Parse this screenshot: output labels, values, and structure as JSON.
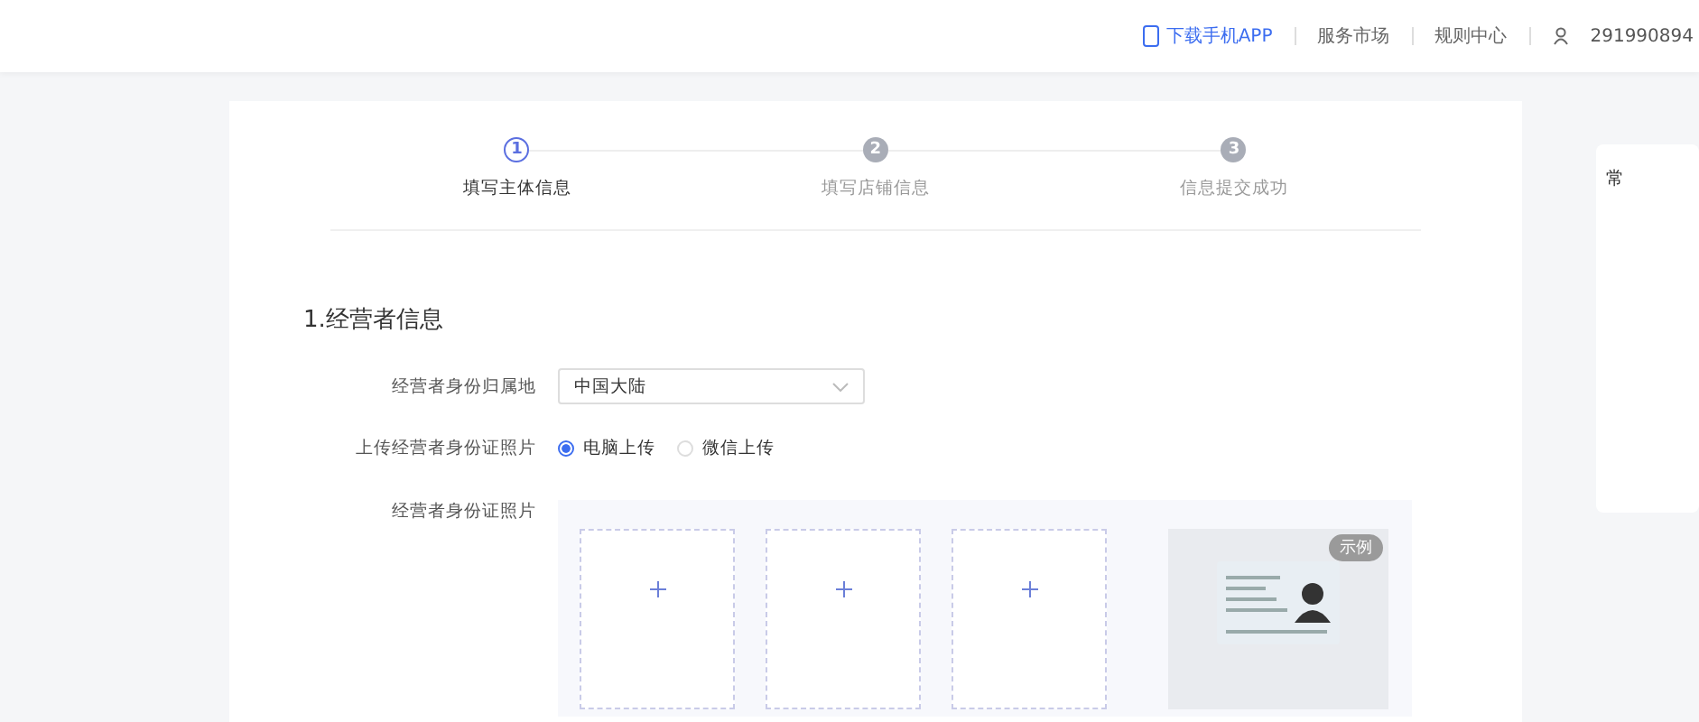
{
  "top_bar": {
    "download_link": "下载手机APP",
    "links": [
      "服务市场",
      "规则中心"
    ],
    "account": "291990894"
  },
  "steps": [
    {
      "number": "1",
      "label": "填写主体信息",
      "selected": true
    },
    {
      "number": "2",
      "label": "填写店铺信息",
      "selected": false
    },
    {
      "number": "3",
      "label": "信息提交成功",
      "selected": false
    }
  ],
  "section_title": "1.经营者信息",
  "region_field": {
    "label": "经营者身份归属地",
    "value": "中国大陆"
  },
  "upload_method": {
    "label": "上传经营者身份证照片",
    "options": [
      {
        "label": "电脑上传",
        "selected": true
      },
      {
        "label": "微信上传",
        "selected": false
      }
    ]
  },
  "photo_field": {
    "label": "经营者身份证照片",
    "upload_slots": [
      {
        "kind": "upload"
      },
      {
        "kind": "upload"
      },
      {
        "kind": "upload"
      }
    ],
    "example_badge": "示例"
  },
  "side_panel": {
    "title": "常"
  }
}
